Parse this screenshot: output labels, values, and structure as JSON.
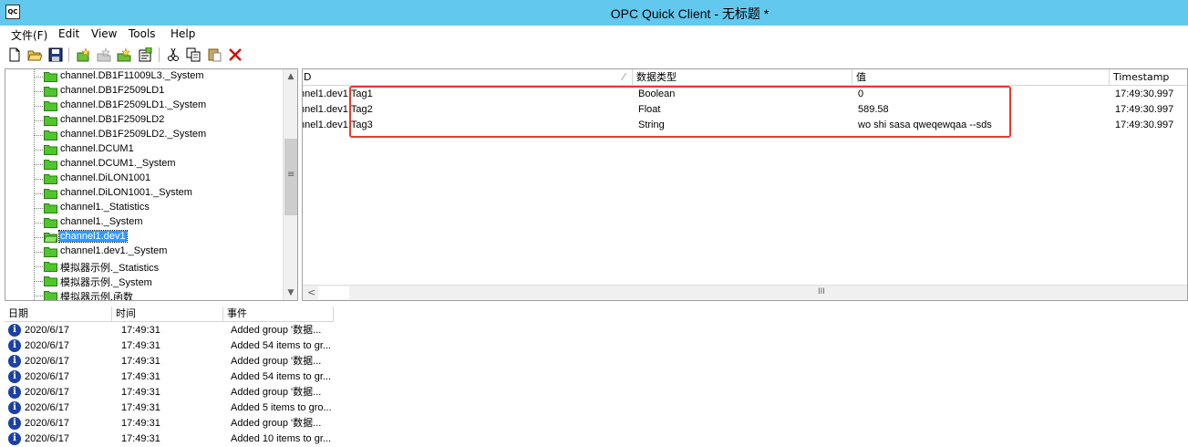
{
  "window": {
    "title": "OPC Quick Client - 无标题 *",
    "icon_text": "QC"
  },
  "menu": [
    "文件(F)",
    "Edit",
    "View",
    "Tools",
    "Help"
  ],
  "toolbar": [
    "new-file-icon",
    "open-folder-icon",
    "save-icon",
    "new-server-icon",
    "new-group-icon",
    "new-item-icon",
    "properties-icon",
    "cut-icon",
    "copy-icon",
    "paste-icon",
    "delete-icon"
  ],
  "tree": {
    "items": [
      {
        "label": "channel.DB1F11009L3._System",
        "selected": false
      },
      {
        "label": "channel.DB1F2509LD1",
        "selected": false
      },
      {
        "label": "channel.DB1F2509LD1._System",
        "selected": false
      },
      {
        "label": "channel.DB1F2509LD2",
        "selected": false
      },
      {
        "label": "channel.DB1F2509LD2._System",
        "selected": false
      },
      {
        "label": "channel.DCUM1",
        "selected": false
      },
      {
        "label": "channel.DCUM1._System",
        "selected": false
      },
      {
        "label": "channel.DiLON1001",
        "selected": false
      },
      {
        "label": "channel.DiLON1001._System",
        "selected": false
      },
      {
        "label": "channel1._Statistics",
        "selected": false
      },
      {
        "label": "channel1._System",
        "selected": false
      },
      {
        "label": "channel1.dev1",
        "selected": true
      },
      {
        "label": "channel1.dev1._System",
        "selected": false
      },
      {
        "label": "模拟器示例._Statistics",
        "selected": false
      },
      {
        "label": "模拟器示例._System",
        "selected": false
      },
      {
        "label": "模拟器示例.函数",
        "selected": false
      }
    ],
    "scroll_up": "▲",
    "scroll_down": "▼",
    "scroll_grip": "≡"
  },
  "items_list": {
    "columns": [
      "D",
      "数据类型",
      "值",
      "Timestamp"
    ],
    "sort_arrow": "⁄",
    "rows": [
      {
        "id": "nnel1.dev1.Tag1",
        "type": "Boolean",
        "value": "0",
        "timestamp": "17:49:30.997"
      },
      {
        "id": "nnel1.dev1.Tag2",
        "type": "Float",
        "value": "589.58",
        "timestamp": "17:49:30.997"
      },
      {
        "id": "nnel1.dev1.Tag3",
        "type": "String",
        "value": "wo shi sasa qweqewqaa --sds",
        "timestamp": "17:49:30.997"
      }
    ],
    "scroll_left": "<",
    "scroll_grip": "III",
    "highlight_color": "#e53a2e"
  },
  "log": {
    "columns": [
      "日期",
      "时间",
      "事件"
    ],
    "info_glyph": "i",
    "rows": [
      {
        "date": "2020/6/17",
        "time": "17:49:31",
        "event": "Added group '数据..."
      },
      {
        "date": "2020/6/17",
        "time": "17:49:31",
        "event": "Added 54 items to gr..."
      },
      {
        "date": "2020/6/17",
        "time": "17:49:31",
        "event": "Added group '数据..."
      },
      {
        "date": "2020/6/17",
        "time": "17:49:31",
        "event": "Added 54 items to gr..."
      },
      {
        "date": "2020/6/17",
        "time": "17:49:31",
        "event": "Added group '数据..."
      },
      {
        "date": "2020/6/17",
        "time": "17:49:31",
        "event": "Added 5 items to gro..."
      },
      {
        "date": "2020/6/17",
        "time": "17:49:31",
        "event": "Added group '数据..."
      },
      {
        "date": "2020/6/17",
        "time": "17:49:31",
        "event": "Added 10 items to gr..."
      }
    ]
  }
}
